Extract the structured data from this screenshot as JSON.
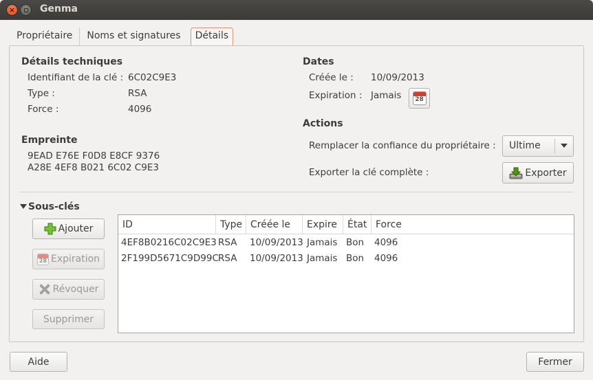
{
  "window": {
    "title": "Genma"
  },
  "tabs": [
    {
      "label": "Propriétaire"
    },
    {
      "label": "Noms et signatures"
    },
    {
      "label": "Détails"
    }
  ],
  "tech": {
    "heading": "Détails techniques",
    "id_label": "Identifiant de la clé :",
    "id_value": "6C02C9E3",
    "type_label": "Type :",
    "type_value": "RSA",
    "force_label": "Force :",
    "force_value": "4096"
  },
  "fingerprint": {
    "heading": "Empreinte",
    "line1": "9EAD E76E F0D8 E8CF 9376",
    "line2": "A28E 4EF8 B021 6C02 C9E3"
  },
  "dates": {
    "heading": "Dates",
    "created_label": "Créée le :",
    "created_value": "10/09/2013",
    "expiry_label": "Expiration :",
    "expiry_value": "Jamais",
    "calendar_day": "28"
  },
  "actions": {
    "heading": "Actions",
    "trust_label": "Remplacer la confiance du propriétaire :",
    "trust_value": "Ultime",
    "export_label": "Exporter la clé complète :",
    "export_button": "Exporter"
  },
  "subkeys": {
    "heading": "Sous-clés",
    "add_button": "Ajouter",
    "expire_button": "Expiration",
    "revoke_button": "Révoquer",
    "delete_button": "Supprimer",
    "columns": [
      "ID",
      "Type",
      "Créée le",
      "Expire",
      "État",
      "Force"
    ],
    "rows": [
      {
        "id": "4EF8B0216C02C9E3",
        "type": "RSA",
        "created": "10/09/2013",
        "expire": "Jamais",
        "state": "Bon",
        "force": "4096"
      },
      {
        "id": "2F199D5671C9D99C",
        "type": "RSA",
        "created": "10/09/2013",
        "expire": "Jamais",
        "state": "Bon",
        "force": "4096"
      }
    ]
  },
  "footer": {
    "help_button": "Aide",
    "close_button": "Fermer"
  }
}
